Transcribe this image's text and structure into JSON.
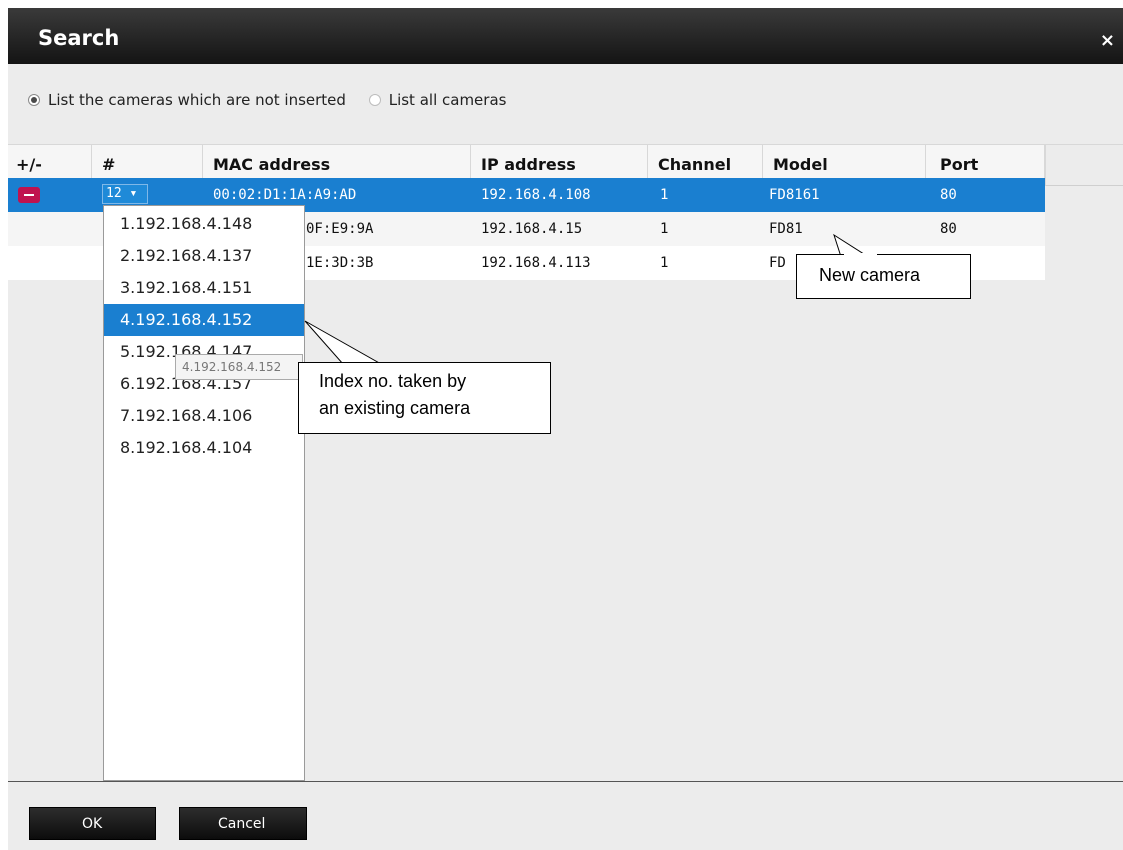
{
  "dialog": {
    "title": "Search",
    "close": "×"
  },
  "radios": [
    {
      "label": "List the cameras which are not inserted",
      "selected": true
    },
    {
      "label": "List all cameras",
      "selected": false
    }
  ],
  "table": {
    "columns": [
      "+/-",
      "#",
      "MAC address",
      "IP address",
      "Channel",
      "Model",
      "Port"
    ],
    "rows": [
      {
        "index": "12 ▾",
        "mac": "00:02:D1:1A:A9:AD",
        "ip": "192.168.4.108",
        "channel": "1",
        "model": "FD8161",
        "port": "80"
      },
      {
        "index": "",
        "mac": "0F:E9:9A",
        "ip": "192.168.4.15",
        "channel": "1",
        "model": "FD81",
        "port": "80"
      },
      {
        "index": "",
        "mac": "1E:3D:3B",
        "ip": "192.168.4.113",
        "channel": "1",
        "model": "FD",
        "port": ""
      }
    ]
  },
  "dropdown": {
    "options": [
      "1.192.168.4.148",
      "2.192.168.4.137",
      "3.192.168.4.151",
      "4.192.168.4.152",
      "5.192.168.4.147",
      "6.192.168.4.157",
      "7.192.168.4.106",
      "8.192.168.4.104"
    ],
    "highlighted": "4.192.168.4.152",
    "tooltip": "4.192.168.4.152"
  },
  "callouts": {
    "new_camera": "New camera",
    "index_taken_line1": "Index no. taken by",
    "index_taken_line2": "an existing camera"
  },
  "footer": {
    "ok": "OK",
    "cancel": "Cancel"
  },
  "colors": {
    "selection": "#1a7fd0",
    "remove": "#c0134f",
    "titlebar": "#1e1e1e"
  }
}
